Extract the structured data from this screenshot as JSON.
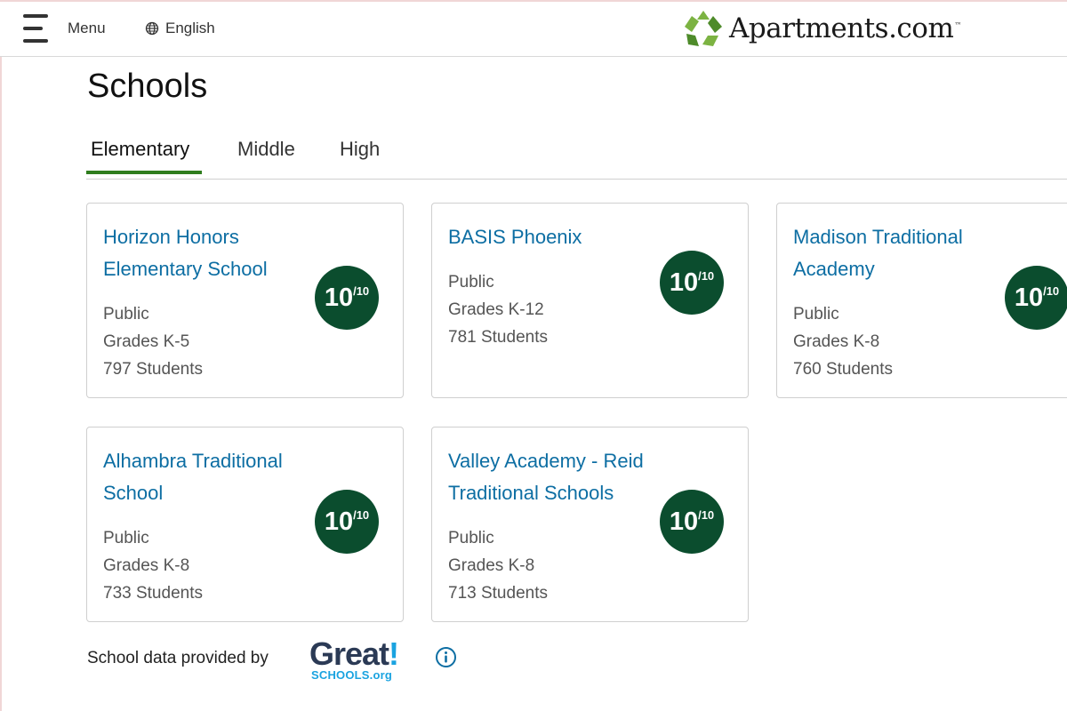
{
  "header": {
    "menu_label": "Menu",
    "language_label": "English",
    "logo_text": "Apartments.com",
    "logo_tm": "™"
  },
  "page": {
    "title": "Schools"
  },
  "tabs": [
    {
      "label": "Elementary",
      "active": true
    },
    {
      "label": "Middle",
      "active": false
    },
    {
      "label": "High",
      "active": false
    }
  ],
  "schools": [
    {
      "name": "Horizon Honors Elementary School",
      "type": "Public",
      "grades": "Grades K-5",
      "students": "797 Students",
      "rating": "10",
      "rating_max": "/10"
    },
    {
      "name": "BASIS Phoenix",
      "type": "Public",
      "grades": "Grades K-12",
      "students": "781 Students",
      "rating": "10",
      "rating_max": "/10"
    },
    {
      "name": "Madison Traditional Academy",
      "type": "Public",
      "grades": "Grades K-8",
      "students": "760 Students",
      "rating": "10",
      "rating_max": "/10"
    },
    {
      "name": "Alhambra Traditional School",
      "type": "Public",
      "grades": "Grades K-8",
      "students": "733 Students",
      "rating": "10",
      "rating_max": "/10"
    },
    {
      "name": "Valley Academy - Reid Traditional Schools",
      "type": "Public",
      "grades": "Grades K-8",
      "students": "713 Students",
      "rating": "10",
      "rating_max": "/10"
    }
  ],
  "footer": {
    "provided_by": "School data provided by",
    "provider_logo_main": "Great",
    "provider_logo_bang": "!",
    "provider_logo_sub": "SCHOOLS.org"
  },
  "colors": {
    "link": "#0d6ea3",
    "rating_bg": "#0b4d2e",
    "tab_active": "#2f7d1e",
    "logo_green": "#7cb342"
  }
}
